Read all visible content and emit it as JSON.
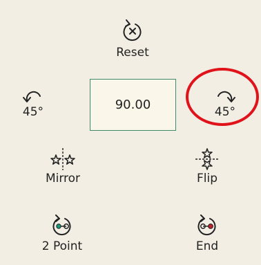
{
  "rotation": {
    "reset_label": "Reset",
    "angle_value": "90.00",
    "rotate_left_label": "45°",
    "rotate_right_label": "45°"
  },
  "transform": {
    "mirror_label": "Mirror",
    "flip_label": "Flip"
  },
  "align": {
    "two_point_label": "2 Point",
    "end_label": "End"
  },
  "colors": {
    "background": "#f2eee4",
    "angle_box_border": "#3d8a6a",
    "highlight_ring": "#e0121a",
    "two_point_dot": "#1a9a7a",
    "end_dot": "#c0202a"
  },
  "icons": {
    "reset": "reset-icon",
    "rotate_left": "rotate-left-icon",
    "rotate_right": "rotate-right-icon",
    "mirror": "mirror-icon",
    "flip": "flip-icon",
    "two_point": "two-point-icon",
    "end": "end-icon"
  }
}
